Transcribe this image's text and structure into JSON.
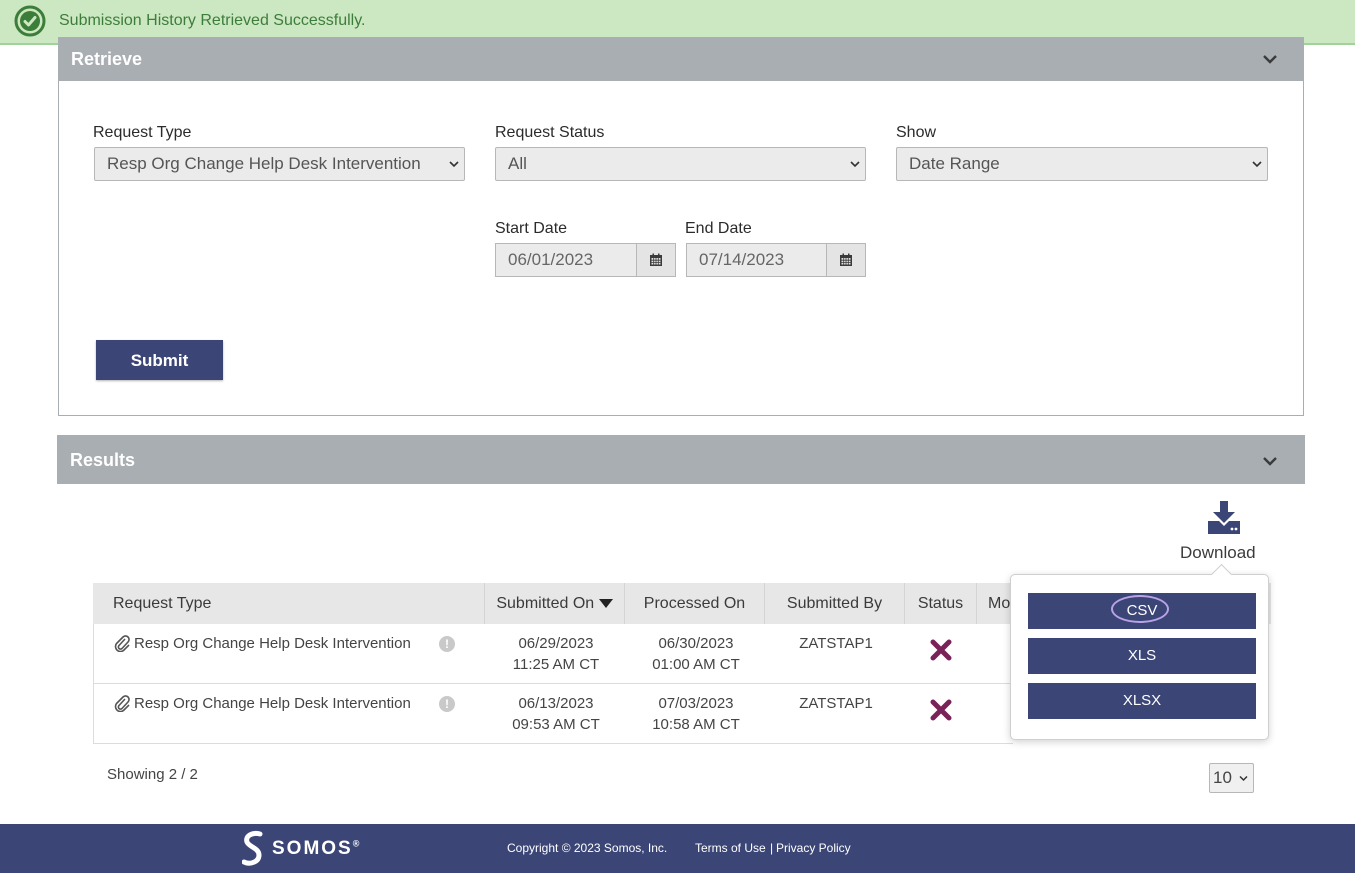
{
  "banner": {
    "message": "Submission History Retrieved Successfully."
  },
  "retrieve": {
    "title": "Retrieve",
    "request_type_label": "Request Type",
    "request_type_value": "Resp Org Change Help Desk Intervention",
    "request_status_label": "Request Status",
    "request_status_value": "All",
    "show_label": "Show",
    "show_value": "Date Range",
    "start_date_label": "Start Date",
    "start_date_value": "06/01/2023",
    "end_date_label": "End Date",
    "end_date_value": "07/14/2023",
    "submit_label": "Submit"
  },
  "results": {
    "title": "Results",
    "download_label": "Download",
    "columns": [
      "Request Type",
      "Submitted On",
      "Processed On",
      "Submitted By",
      "Status",
      "Mo"
    ],
    "rows": [
      {
        "request_type": "Resp Org Change Help Desk Intervention",
        "submitted_date": "06/29/2023",
        "submitted_time": "11:25 AM CT",
        "processed_date": "06/30/2023",
        "processed_time": "01:00 AM CT",
        "submitted_by": "ZATSTAP1",
        "status_icon": "x-mark-icon"
      },
      {
        "request_type": "Resp Org Change Help Desk Intervention",
        "submitted_date": "06/13/2023",
        "submitted_time": "09:53 AM CT",
        "processed_date": "07/03/2023",
        "processed_time": "10:58 AM CT",
        "submitted_by": "ZATSTAP1",
        "status_icon": "x-mark-icon"
      }
    ],
    "showing": "Showing 2 / 2",
    "page_size": "10"
  },
  "download_menu": {
    "options": [
      "CSV",
      "XLS",
      "XLSX"
    ]
  },
  "footer": {
    "logo_text": "SOMOS",
    "logo_reg": "®",
    "copyright": "Copyright © 2023 Somos, Inc.",
    "terms": "Terms of Use",
    "separator": "|",
    "privacy": "Privacy Policy"
  },
  "colors": {
    "banner_bg": "#cce8c2",
    "banner_text": "#3d7d3a",
    "panel_header": "#a9aeb2",
    "primary": "#3b4677",
    "status_failed": "#7a2359"
  }
}
